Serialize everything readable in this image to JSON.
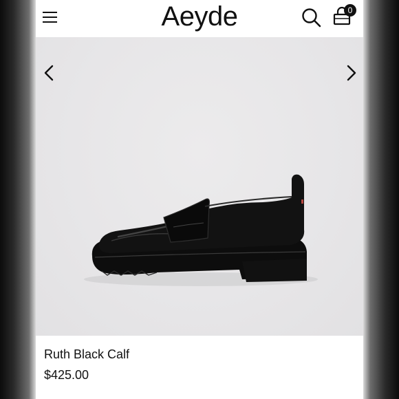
{
  "header": {
    "logo": "Aeyde",
    "cart_count": "0",
    "menu_icon": "hamburger-icon",
    "search_icon": "search-icon",
    "cart_icon": "shopping-bag-icon"
  },
  "gallery": {
    "prev_icon": "chevron-left-icon",
    "next_icon": "chevron-right-icon",
    "image_alt": "black leather loafer"
  },
  "product": {
    "name": "Ruth Black Calf",
    "price": "$425.00"
  }
}
